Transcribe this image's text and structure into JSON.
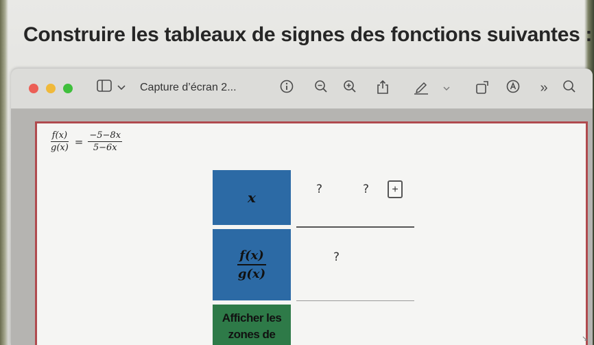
{
  "page": {
    "heading": "Construire les tableaux de signes des fonctions suivantes :"
  },
  "window": {
    "title": "Capture d’écran 2...",
    "icons": [
      "sidebar-toggle-icon",
      "chevron-down-icon",
      "info-icon",
      "zoom-out-icon",
      "zoom-in-icon",
      "share-icon",
      "markup-pen-icon",
      "chevron-down-icon",
      "rotate-icon",
      "annotate-icon",
      "more-icon",
      "search-icon"
    ]
  },
  "formula": {
    "lhs_num": "f(x)",
    "lhs_den": "g(x)",
    "eq": "=",
    "rhs_num": "−5−8x",
    "rhs_den": "5−6x"
  },
  "table": {
    "x_label": "x",
    "f_num": "f(x)",
    "f_den": "g(x)",
    "x_values": [
      "?",
      "?"
    ],
    "sign_value": "?",
    "add_button": "+",
    "show_button_line1": "Afficher les",
    "show_button_line2": "zones de"
  },
  "colors": {
    "header_blue": "#2c6aa5",
    "button_green": "#2e7a48",
    "frame_red": "#b04a4e"
  }
}
